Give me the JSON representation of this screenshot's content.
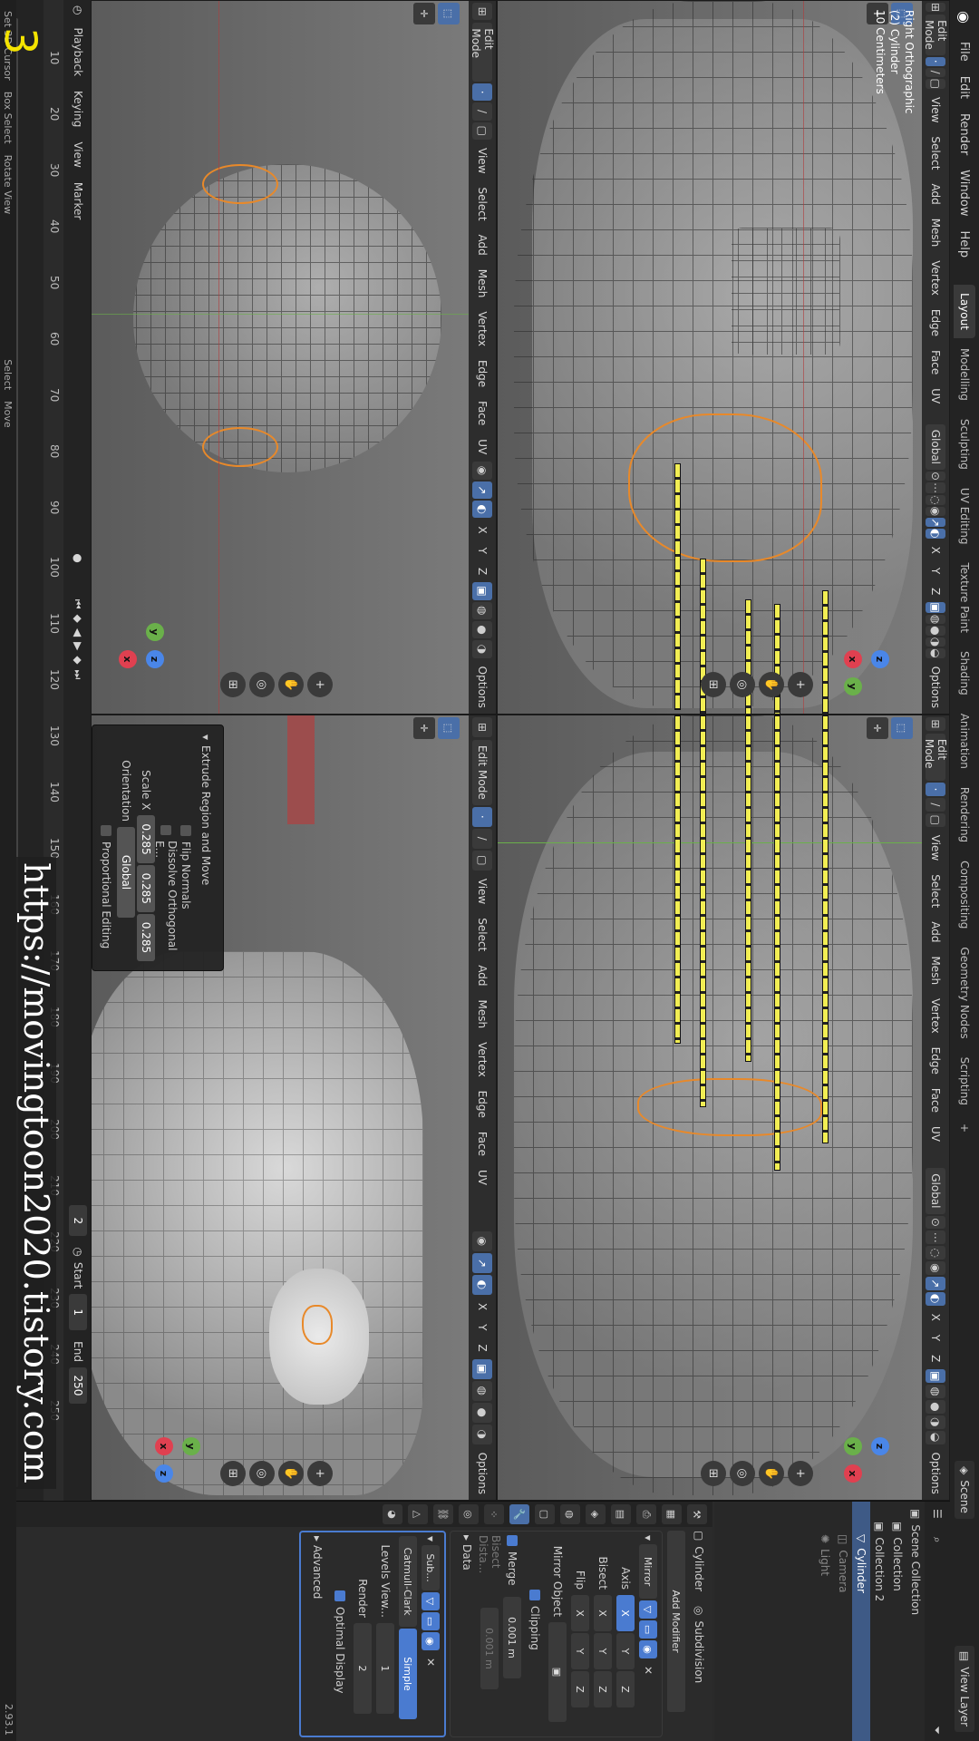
{
  "app": {
    "menu": [
      "File",
      "Edit",
      "Render",
      "Window",
      "Help"
    ],
    "workspaces": [
      "Layout",
      "Modelling",
      "Sculpting",
      "UV Editing",
      "Texture Paint",
      "Shading",
      "Animation",
      "Rendering",
      "Compositing",
      "Geometry Nodes",
      "Scripting"
    ],
    "active_workspace": "Layout",
    "add_tab": "+",
    "scene": "Scene",
    "view_layer": "View Layer",
    "version": "2.93.1"
  },
  "viewport_header": {
    "mode": "Edit Mode",
    "view": "View",
    "select": "Select",
    "add": "Add",
    "mesh": "Mesh",
    "vertex": "Vertex",
    "edge": "Edge",
    "face": "Face",
    "uv": "UV",
    "orientation": "Global",
    "x": "X",
    "y": "Y",
    "z": "Z",
    "options": "Options"
  },
  "viewport_main": {
    "line1": "Right Orthographic",
    "line2": "(2) Cylinder",
    "line3": "10 Centimeters"
  },
  "operator_panel": {
    "title": "Extrude Region and Move",
    "flip_normals": "Flip Normals",
    "dissolve": "Dissolve Orthogonal E...",
    "scale_x_label": "Scale X",
    "y_label": "Y",
    "z_label": "Z",
    "scale_x": "0.285",
    "scale_y": "0.285",
    "scale_z": "0.285",
    "orientation_label": "Orientation",
    "orientation": "Global",
    "proportional": "Proportional Editing"
  },
  "timeline": {
    "playback": "Playback",
    "keying": "Keying",
    "view": "View",
    "marker": "Marker",
    "ticks": [
      "10",
      "20",
      "30",
      "40",
      "50",
      "60",
      "70",
      "80",
      "90",
      "100",
      "110",
      "120",
      "130",
      "140",
      "150",
      "160",
      "170",
      "180",
      "190",
      "200",
      "210",
      "220",
      "230",
      "240",
      "250"
    ],
    "current_frame": "2",
    "start_label": "Start",
    "start": "1",
    "end_label": "End",
    "end": "250"
  },
  "status": {
    "items": [
      "Set 3D Cursor",
      "Box Select",
      "Rotate View",
      "Select",
      "Move"
    ]
  },
  "overlay": {
    "watermark": "https://movingtoon2020.tistory.com",
    "number": "3"
  },
  "outliner": {
    "rows": [
      "Scene Collection",
      "Collection",
      "Collection 2",
      "Cylinder",
      "Camera",
      "Light"
    ]
  },
  "properties": {
    "object_name": "Cylinder",
    "modifier_name": "Subdivision",
    "add_modifier": "Add Modifier",
    "mirror": "Mirror",
    "axis": "Axis",
    "bisect": "Bisect",
    "flip": "Flip",
    "x": "X",
    "y": "Y",
    "z": "Z",
    "mirror_object": "Mirror Object",
    "clipping": "Clipping",
    "merge": "Merge",
    "merge_value": "0.001 m",
    "bisect_distance": "Bisect Dista...",
    "bisect_value": "0.001 m",
    "data": "Data",
    "sub": "Sub...",
    "catmull": "Catmull-Clark",
    "simple": "Simple",
    "levels_viewport": "Levels View...",
    "levels_value": "1",
    "render": "Render",
    "render_value": "2",
    "optimal": "Optimal Display",
    "advanced": "Advanced"
  },
  "colors": {
    "accent": "#4a7bd0",
    "selection": "#e8892a",
    "guide": "#f2ee54"
  }
}
